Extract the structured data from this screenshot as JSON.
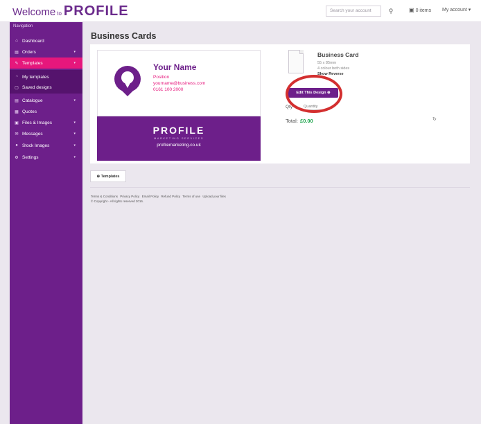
{
  "header": {
    "welcome": "Welcome",
    "to": "to",
    "logo": "PROFILE",
    "search_placeholder": "Search your account",
    "search_icon": "search-icon",
    "cart_label": "0 items",
    "account_label": "My account ▾"
  },
  "sidebar": {
    "heading": "Navigation",
    "items": [
      {
        "label": "Dashboard",
        "icon": "dashboard-icon",
        "glyph": "⌂"
      },
      {
        "label": "Orders",
        "icon": "orders-icon",
        "glyph": "▤",
        "caret": "▾"
      },
      {
        "label": "Templates",
        "icon": "templates-icon",
        "glyph": "✎",
        "caret": "▾"
      },
      {
        "label": "Catalogue",
        "icon": "catalogue-icon",
        "glyph": "▤",
        "caret": "▾"
      },
      {
        "label": "Quotes",
        "icon": "quotes-icon",
        "glyph": "▦"
      },
      {
        "label": "Files & Images",
        "icon": "files-icon",
        "glyph": "▣",
        "caret": "▾"
      },
      {
        "label": "Messages",
        "icon": "messages-icon",
        "glyph": "✉",
        "caret": "▾"
      },
      {
        "label": "Stock Images",
        "icon": "stock-images-icon",
        "glyph": "●",
        "caret": "▾"
      },
      {
        "label": "Settings",
        "icon": "settings-icon",
        "glyph": "⚙",
        "caret": "▾"
      }
    ],
    "subitems": [
      {
        "label": "My templates",
        "icon": "my-templates-icon",
        "glyph": "◔"
      },
      {
        "label": "Saved designs",
        "icon": "saved-designs-icon",
        "glyph": "▢"
      }
    ]
  },
  "main": {
    "title": "Business Cards",
    "card": {
      "name": "Your Name",
      "position": "Position",
      "email": "yourname@business.com",
      "phone": "0161 100 2000",
      "back_logo": "PROFILE",
      "back_sub": "MARKETING SERVICES",
      "back_web": "profilemarketing.co.uk"
    },
    "product": {
      "title": "Business Card",
      "size": "55 x 85mm",
      "colour": "4 colour both sides",
      "reverse": "Show Reverse",
      "edit_label": "Edit This Design ⊕",
      "quantity_label": "Qty",
      "quantity_placeholder": "Quantity",
      "total_label": "Total:",
      "total_value": "£0.00",
      "refresh_glyph": "↻"
    },
    "templates_button": "⊕ Templates",
    "footer_links": [
      "Terms & Conditions",
      "Privacy Policy",
      "Email Policy",
      "Refund Policy",
      "Terms of use",
      "Upload your files"
    ],
    "copyright": "© Copyright - All rights reserved 2016."
  },
  "colors": {
    "brand_purple": "#6d1f8a",
    "accent_pink": "#e6177c",
    "total_green": "#1aa44a",
    "highlight_red": "#d32f2f"
  }
}
